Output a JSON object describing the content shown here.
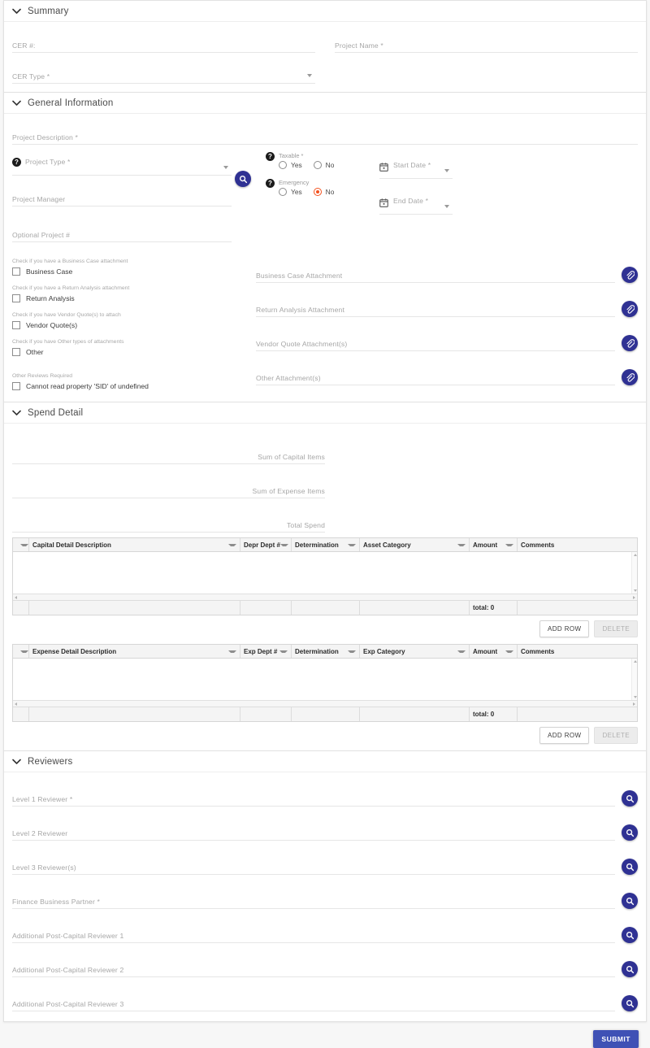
{
  "colors": {
    "accent_blue": "#2f3193",
    "submit_blue": "#3f51b5",
    "radio_selected_orange": "#f4511e",
    "help_icon_dark": "#1b1b1b",
    "page_background": "#f7f7f7"
  },
  "summary": {
    "title": "Summary",
    "chevron": "chevron-down-icon",
    "cer_number": {
      "label": "CER #:",
      "value": ""
    },
    "project_name": {
      "label": "Project Name *",
      "value": ""
    },
    "cer_type": {
      "label": "CER Type *",
      "value": ""
    }
  },
  "general_information": {
    "title": "General Information",
    "chevron": "chevron-down-icon",
    "project_description": {
      "label": "Project Description *",
      "value": ""
    },
    "project_type": {
      "label": "Project Type *",
      "value": "",
      "help": "help-icon"
    },
    "project_manager": {
      "label": "Project Manager",
      "value": "",
      "search": "search-icon"
    },
    "optional_project_number": {
      "label": "Optional Project #",
      "value": ""
    },
    "taxable": {
      "label": "Taxable *",
      "help": "help-icon",
      "options": [
        "Yes",
        "No"
      ],
      "selected": ""
    },
    "emergency": {
      "label": "Emergency",
      "help": "help-icon",
      "options": [
        "Yes",
        "No"
      ],
      "selected": "No"
    },
    "start_date": {
      "label": "Start Date *",
      "value": "",
      "icon": "calendar-icon"
    },
    "end_date": {
      "label": "End Date *",
      "value": "",
      "icon": "calendar-icon"
    },
    "attachment_checks": [
      {
        "hint": "Check if you have a Business Case attachment",
        "label": "Business Case",
        "checked": false
      },
      {
        "hint": "Check if you have a Return Analysis attachment",
        "label": "Return Analysis",
        "checked": false
      },
      {
        "hint": "Check if you have Vendor Quote(s) to attach",
        "label": "Vendor Quote(s)",
        "checked": false
      },
      {
        "hint": "Check if you have Other types of attachments",
        "label": "Other",
        "checked": false
      }
    ],
    "other_reviews": {
      "hint": "Other Reviews Required",
      "label": "Cannot read property 'SID' of undefined",
      "checked": false
    },
    "attachment_fields": [
      {
        "label": "Business Case Attachment",
        "value": "",
        "icon": "attachment-icon"
      },
      {
        "label": "Return Analysis Attachment",
        "value": "",
        "icon": "attachment-icon"
      },
      {
        "label": "Vendor Quote Attachment(s)",
        "value": "",
        "icon": "attachment-icon"
      },
      {
        "label": "Other Attachment(s)",
        "value": "",
        "icon": "attachment-icon"
      }
    ]
  },
  "spend_detail": {
    "title": "Spend Detail",
    "chevron": "chevron-down-icon",
    "sums": [
      {
        "label": "Sum of Capital Items",
        "value": ""
      },
      {
        "label": "Sum of Expense Items",
        "value": ""
      },
      {
        "label": "Total Spend",
        "value": ""
      }
    ],
    "capital_table": {
      "columns": [
        "Capital Detail Description",
        "Depr Dept #",
        "Determination",
        "Asset Category",
        "Amount",
        "Comments"
      ],
      "rows": [],
      "total_label": "total: 0",
      "add_row_label": "ADD ROW",
      "delete_label": "DELETE",
      "delete_disabled": true
    },
    "expense_table": {
      "columns": [
        "Expense Detail Description",
        "Exp Dept #",
        "Determination",
        "Exp Category",
        "Amount",
        "Comments"
      ],
      "rows": [],
      "total_label": "total: 0",
      "add_row_label": "ADD ROW",
      "delete_label": "DELETE",
      "delete_disabled": true
    }
  },
  "reviewers": {
    "title": "Reviewers",
    "chevron": "chevron-down-icon",
    "fields": [
      {
        "label": "Level 1 Reviewer *",
        "value": "",
        "icon": "search-icon"
      },
      {
        "label": "Level 2 Reviewer",
        "value": "",
        "icon": "search-icon"
      },
      {
        "label": "Level 3 Reviewer(s)",
        "value": "",
        "icon": "search-icon"
      },
      {
        "label": "Finance Business Partner *",
        "value": "",
        "icon": "search-icon"
      },
      {
        "label": "Additional Post-Capital Reviewer 1",
        "value": "",
        "icon": "search-icon"
      },
      {
        "label": "Additional Post-Capital Reviewer 2",
        "value": "",
        "icon": "search-icon"
      },
      {
        "label": "Additional Post-Capital Reviewer 3",
        "value": "",
        "icon": "search-icon"
      }
    ]
  },
  "footer": {
    "submit_label": "SUBMIT"
  }
}
